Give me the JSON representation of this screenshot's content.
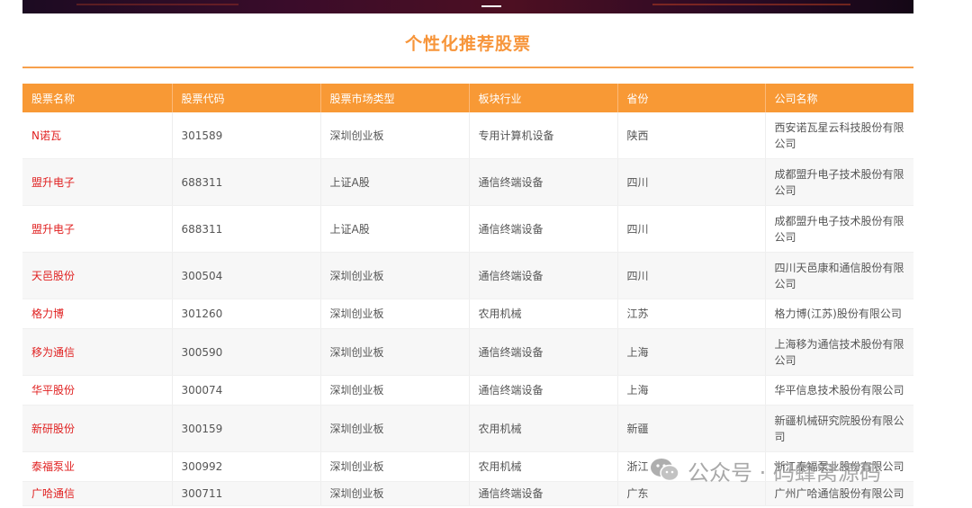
{
  "page": {
    "title": "个性化推荐股票"
  },
  "table": {
    "columns": [
      "股票名称",
      "股票代码",
      "股票市场类型",
      "板块行业",
      "省份",
      "公司名称"
    ],
    "rows": [
      {
        "name": "N诺瓦",
        "code": "301589",
        "market": "深圳创业板",
        "industry": "专用计算机设备",
        "province": "陕西",
        "company": "西安诺瓦星云科技股份有限公司"
      },
      {
        "name": "盟升电子",
        "code": "688311",
        "market": "上证A股",
        "industry": "通信终端设备",
        "province": "四川",
        "company": "成都盟升电子技术股份有限公司"
      },
      {
        "name": "盟升电子",
        "code": "688311",
        "market": "上证A股",
        "industry": "通信终端设备",
        "province": "四川",
        "company": "成都盟升电子技术股份有限公司"
      },
      {
        "name": "天邑股份",
        "code": "300504",
        "market": "深圳创业板",
        "industry": "通信终端设备",
        "province": "四川",
        "company": "四川天邑康和通信股份有限公司"
      },
      {
        "name": "格力博",
        "code": "301260",
        "market": "深圳创业板",
        "industry": "农用机械",
        "province": "江苏",
        "company": "格力博(江苏)股份有限公司"
      },
      {
        "name": "移为通信",
        "code": "300590",
        "market": "深圳创业板",
        "industry": "通信终端设备",
        "province": "上海",
        "company": "上海移为通信技术股份有限公司"
      },
      {
        "name": "华平股份",
        "code": "300074",
        "market": "深圳创业板",
        "industry": "通信终端设备",
        "province": "上海",
        "company": "华平信息技术股份有限公司"
      },
      {
        "name": "新研股份",
        "code": "300159",
        "market": "深圳创业板",
        "industry": "农用机械",
        "province": "新疆",
        "company": "新疆机械研究院股份有限公司"
      },
      {
        "name": "泰福泵业",
        "code": "300992",
        "market": "深圳创业板",
        "industry": "农用机械",
        "province": "浙江",
        "company": "浙江泰福泵业股份有限公司"
      },
      {
        "name": "广哈通信",
        "code": "300711",
        "market": "深圳创业板",
        "industry": "通信终端设备",
        "province": "广东",
        "company": "广州广哈通信股份有限公司"
      }
    ]
  },
  "watermark": {
    "text": "公众号 · 码蜂窝源码",
    "icon": "wechat-icon"
  },
  "colors": {
    "accent": "#f89935",
    "stock_name": "#e02020",
    "title": "#f7953a"
  }
}
